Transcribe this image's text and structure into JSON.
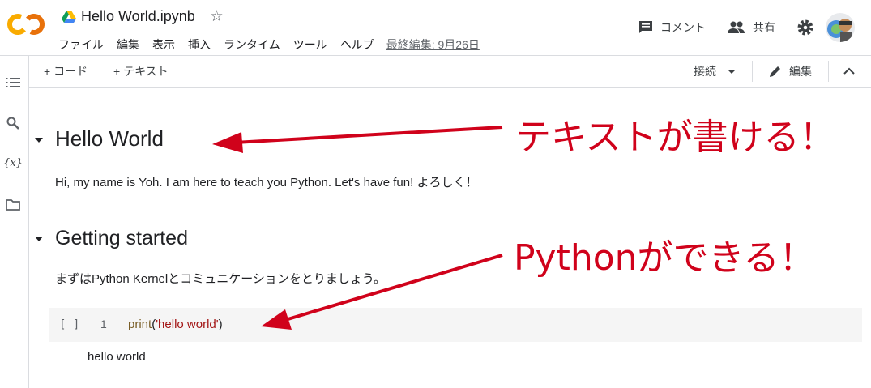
{
  "header": {
    "title": "Hello World.ipynb",
    "menu": [
      "ファイル",
      "編集",
      "表示",
      "挿入",
      "ランタイム",
      "ツール",
      "ヘルプ"
    ],
    "last_edit": "最終編集: 9月26日",
    "comment_label": "コメント",
    "share_label": "共有"
  },
  "toolbar": {
    "add_code": "+ コード",
    "add_text": "+ テキスト",
    "connect": "接続",
    "edit": "編集"
  },
  "notebook": {
    "heading1": "Hello World",
    "para1": "Hi, my name is Yoh. I am here to teach you Python. Let's have fun! よろしく！",
    "heading2": "Getting started",
    "para2": "まずはPython Kernelとコミュニケーションをとりましょう。",
    "cell": {
      "bracket": "[ ]",
      "line_number": "1",
      "code_fn": "print",
      "code_open": "(",
      "code_str": "'hello  world'",
      "code_close": ")",
      "output": "hello world"
    }
  },
  "annotations": {
    "text_note": "テキストが書ける！",
    "python_note": "Pythonができる！",
    "color": "#d0021b"
  },
  "colors": {
    "accent_orange": "#f9ab00",
    "logo_orange": "#e8710a"
  }
}
